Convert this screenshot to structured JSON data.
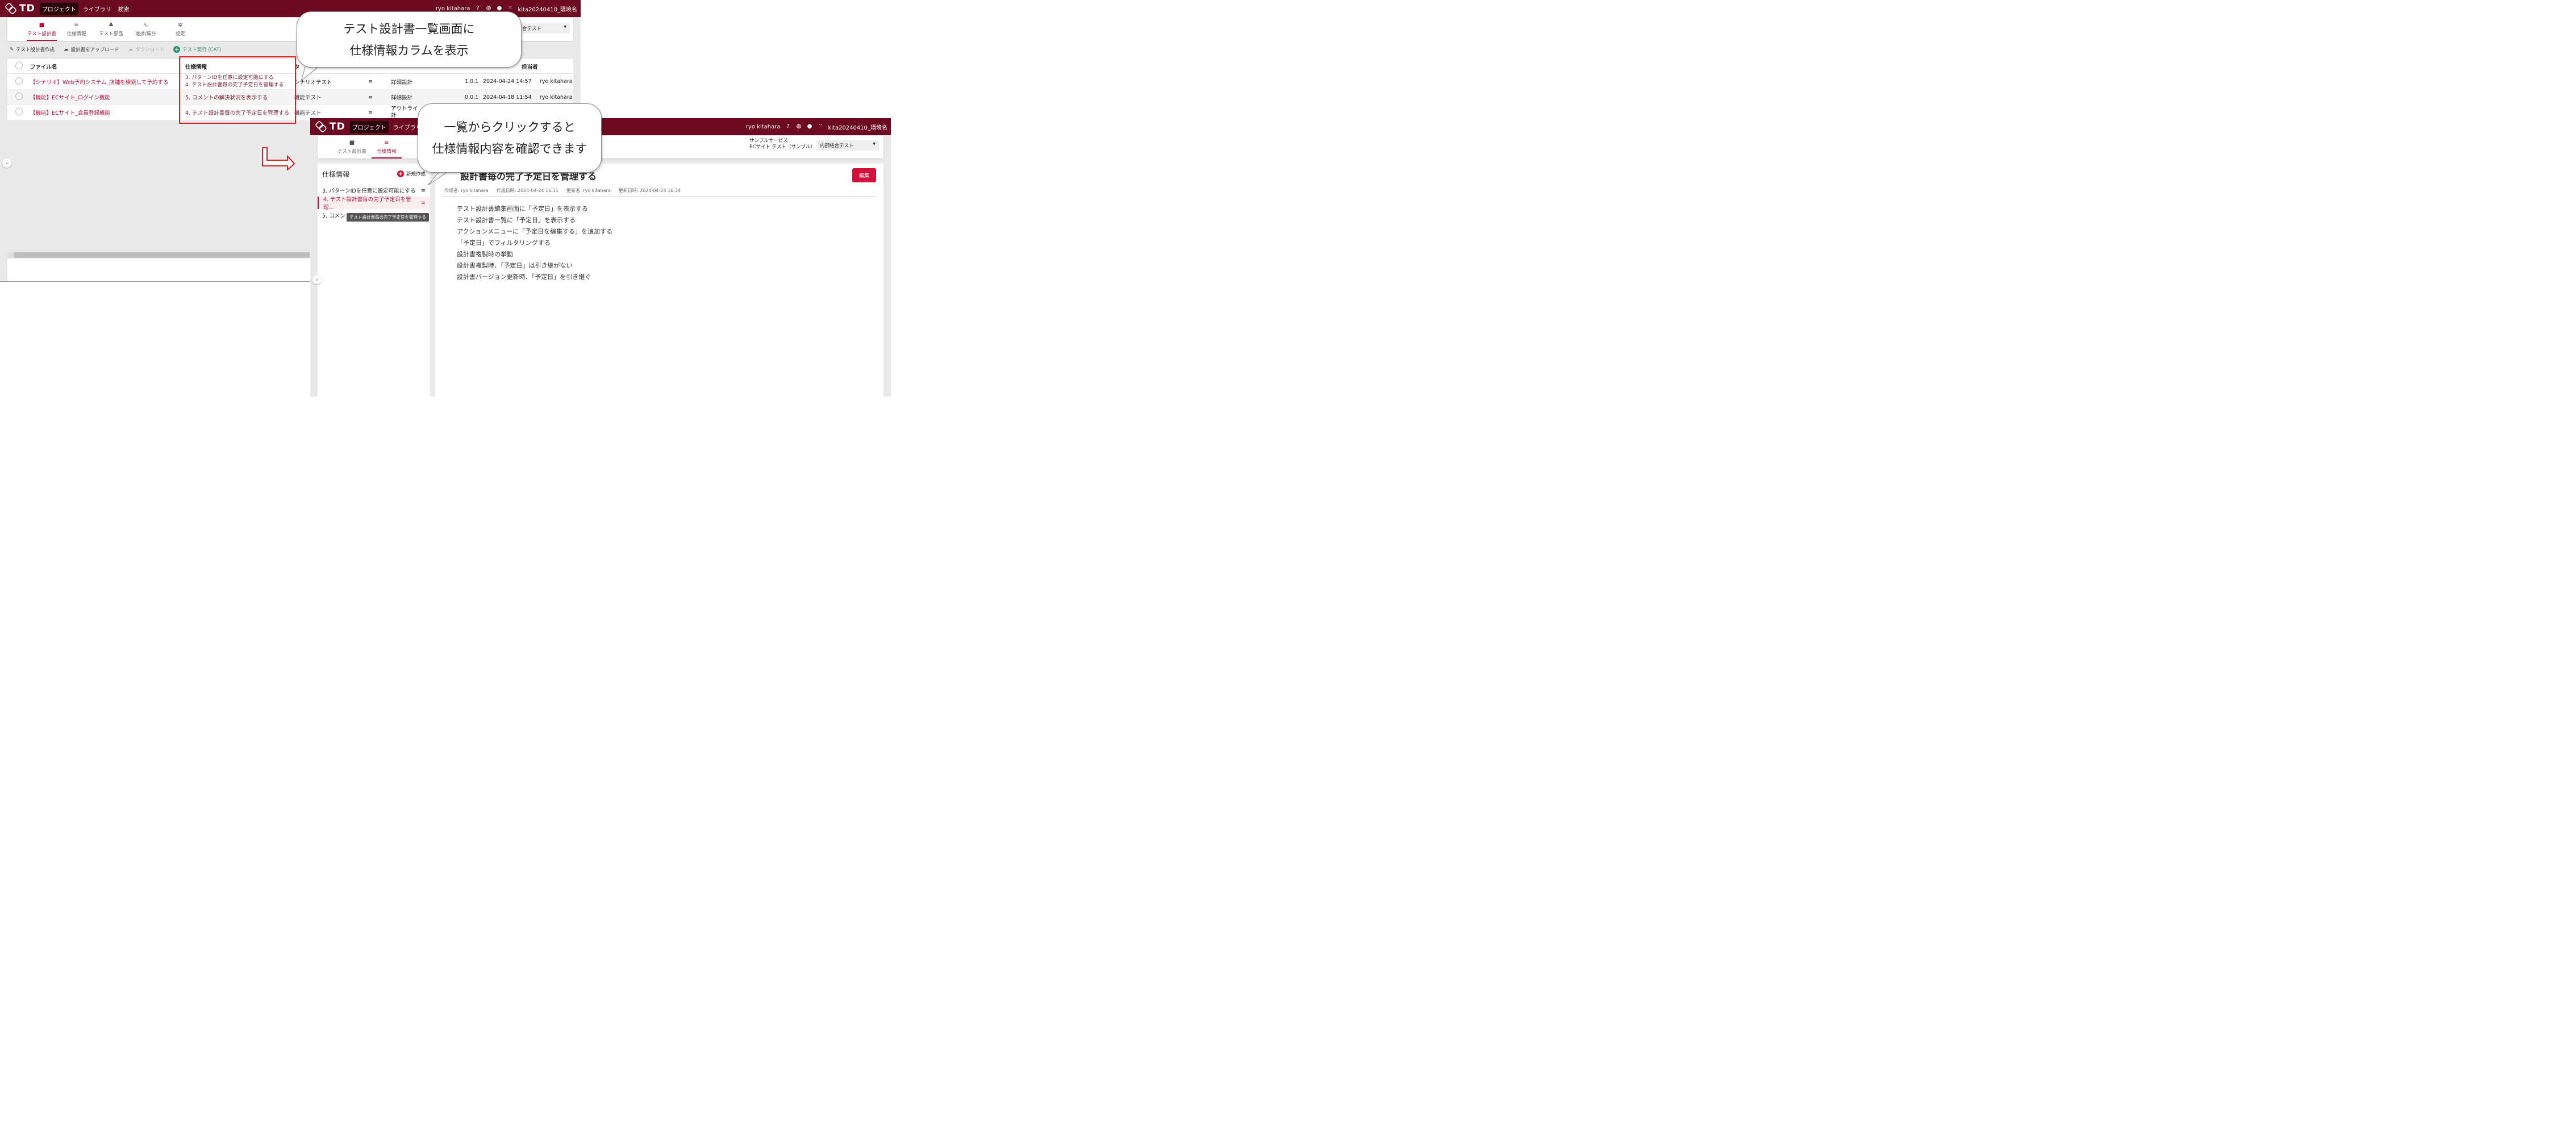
{
  "left": {
    "header": {
      "logo": "TD",
      "logo_sub": "TEST DESIGNER",
      "nav": [
        "プロジェクト",
        "ライブラリ",
        "検索"
      ],
      "user": "ryo kitahara",
      "env": "kita20240410_環境名"
    },
    "tabs": [
      {
        "label": "テスト設計書",
        "icon": "folder-icon"
      },
      {
        "label": "仕様情報",
        "icon": "list-icon"
      },
      {
        "label": "テスト部品",
        "icon": "parts-icon"
      },
      {
        "label": "進捗/集計",
        "icon": "chart-icon"
      },
      {
        "label": "設定",
        "icon": "gear-icon"
      }
    ],
    "select_value": "合テスト",
    "actions": {
      "create": "テスト設計書作成",
      "upload": "設計書をアップロード",
      "download": "ダウンロード",
      "run": "テスト実行 (CAT)"
    },
    "columns": {
      "file": "ファイル名",
      "spec": "仕様情報",
      "type": "タ",
      "owner": "担当者"
    },
    "rows": [
      {
        "file": "【シナリオ】Web予約システム_店舗を検索して予約する",
        "spec1": "3. パターンIDを任意に設定可能にする",
        "spec2": "4. テスト設計書毎の完了予定日を管理する",
        "type": "シナリオテスト",
        "phase": "詳細設計",
        "ver": "1.0.1",
        "date": "2024-04-24 14:57",
        "owner": "ryo kitahara"
      },
      {
        "file": "【機能】ECサイト_ログイン機能",
        "spec1": "5. コメントの解決状況を表示する",
        "spec2": "",
        "type": "機能テスト",
        "phase": "詳細設計",
        "ver": "0.0.1",
        "date": "2024-04-18 11:54",
        "owner": "ryo kitahara"
      },
      {
        "file": "【機能】ECサイト_会員登録機能",
        "spec1": "4. テスト設計書毎の完了予定日を管理する",
        "spec2": "",
        "type": "機能テスト",
        "phase": "アウトライ",
        "phase2": "計",
        "ver": "",
        "date": "",
        "owner": ""
      }
    ]
  },
  "right": {
    "header": {
      "logo": "TD",
      "logo_sub": "TEST DESIGNER",
      "nav": [
        "プロジェクト",
        "ライブラリ",
        "検"
      ],
      "user": "ryo kitahara",
      "env": "kita20240410_環境名"
    },
    "tabs": [
      {
        "label": "テスト設計書",
        "icon": "folder-icon"
      },
      {
        "label": "仕様情報",
        "icon": "list-icon"
      },
      {
        "label": "テ",
        "icon": "parts-icon"
      }
    ],
    "service": "サンプルサービス",
    "service_sub": "ECサイト テスト（サンプル）",
    "select_value": "内部結合テスト",
    "spec_title": "仕様情報",
    "new": "新規作成",
    "items": [
      "3. パターンIDを任意に設定可能にする",
      "4. テスト設計書毎の完了予定日を管理...",
      "5. コメン"
    ],
    "tooltip": "テスト設計書毎の完了予定日を管理する",
    "detail_title": "設計書毎の完了予定日を管理する",
    "edit": "編集",
    "meta": [
      "作成者: ryo kitahara",
      "作成日時: 2024-04-24 16:31",
      "更新者: ryo kitahara",
      "更新日時: 2024-04-24 16:34"
    ],
    "lines": [
      "テスト設計書編集画面に「予定日」を表示する",
      "テスト設計書一覧に「予定日」を表示する",
      "アクションメニューに「予定日を編集する」を追加する",
      "「予定日」でフィルタリングする",
      "設計書複製時の挙動",
      "設計書複製時、「予定日」は引き継がない",
      "設計書バージョン更新時、「予定日」を引き継ぐ"
    ]
  },
  "callouts": {
    "top": [
      "テスト設計書一覧画面に",
      "仕様情報カラムを表示"
    ],
    "bottom": [
      "一覧からクリックすると",
      "仕様情報内容を確認できます"
    ]
  }
}
